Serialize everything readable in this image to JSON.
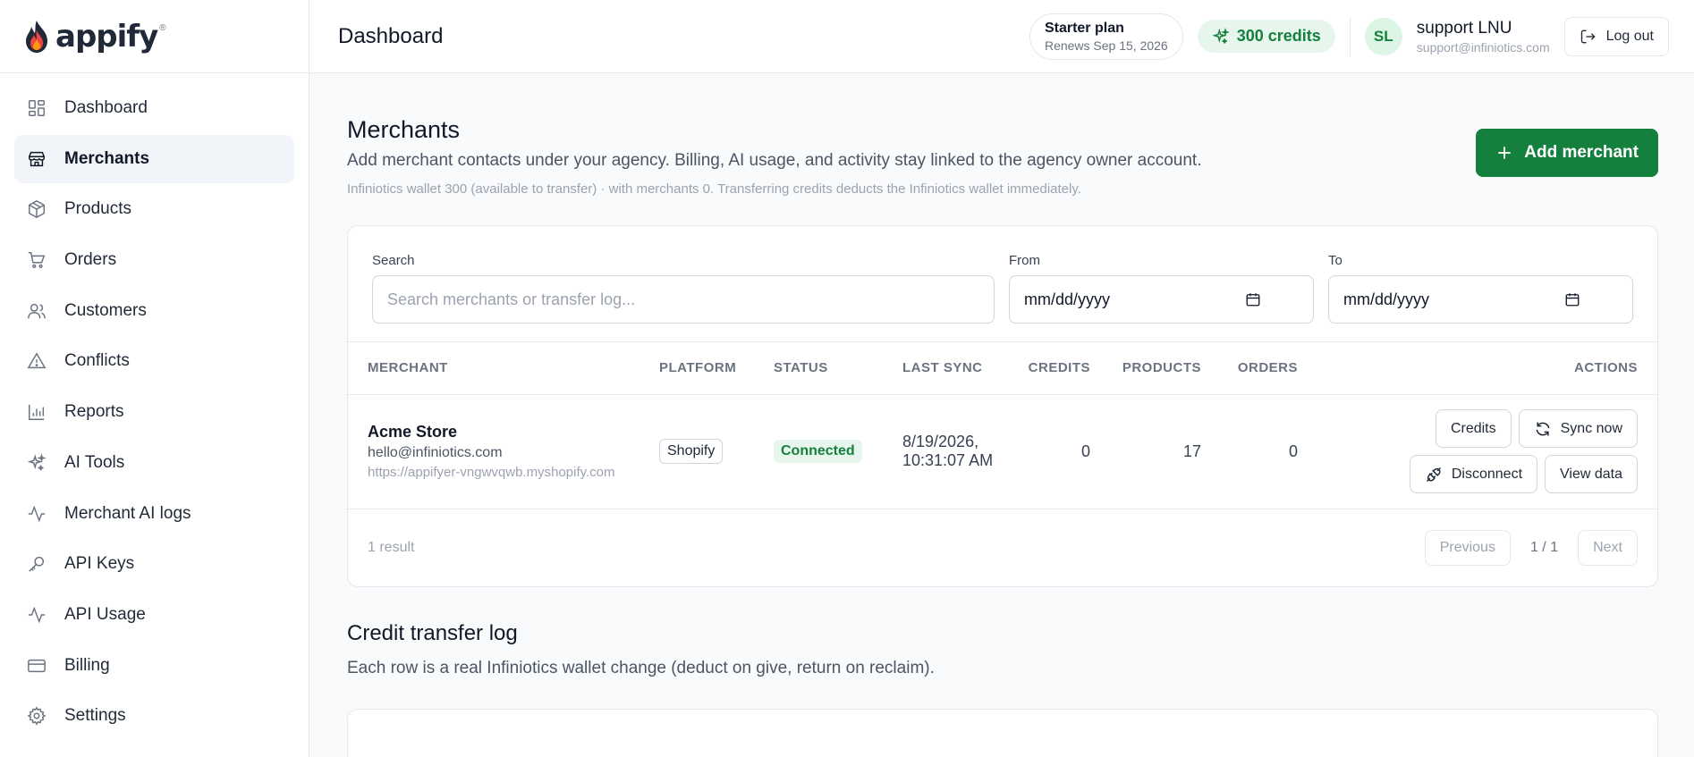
{
  "brand": {
    "name": "appify",
    "reg": "®"
  },
  "sidebar": {
    "items": [
      {
        "label": "Dashboard",
        "icon": "grid-icon"
      },
      {
        "label": "Merchants",
        "icon": "store-icon",
        "active": true
      },
      {
        "label": "Products",
        "icon": "box-icon"
      },
      {
        "label": "Orders",
        "icon": "cart-icon"
      },
      {
        "label": "Customers",
        "icon": "users-icon"
      },
      {
        "label": "Conflicts",
        "icon": "alert-icon"
      },
      {
        "label": "Reports",
        "icon": "bar-chart-icon"
      },
      {
        "label": "AI Tools",
        "icon": "sparkle-icon"
      },
      {
        "label": "Merchant AI logs",
        "icon": "activity-icon"
      },
      {
        "label": "API Keys",
        "icon": "key-icon"
      },
      {
        "label": "API Usage",
        "icon": "activity-icon"
      },
      {
        "label": "Billing",
        "icon": "credit-card-icon"
      },
      {
        "label": "Settings",
        "icon": "gear-icon"
      }
    ]
  },
  "header": {
    "title": "Dashboard",
    "plan": {
      "name": "Starter plan",
      "renews": "Renews Sep 15, 2026"
    },
    "credits": "300 credits",
    "user": {
      "initials": "SL",
      "name": "support LNU",
      "email": "support@infiniotics.com"
    },
    "logout_label": "Log out"
  },
  "page": {
    "title": "Merchants",
    "subtitle": "Add merchant contacts under your agency. Billing, AI usage, and activity stay linked to the agency owner account.",
    "note": "Infiniotics wallet 300 (available to transfer) · with merchants 0. Transferring credits deducts the Infiniotics wallet immediately.",
    "add_label": "Add merchant"
  },
  "filters": {
    "search_label": "Search",
    "search_placeholder": "Search merchants or transfer log...",
    "from_label": "From",
    "from_value": "mm/dd/yyyy",
    "to_label": "To",
    "to_value": "mm/dd/yyyy"
  },
  "table": {
    "headers": {
      "merchant": "MERCHANT",
      "platform": "PLATFORM",
      "status": "STATUS",
      "last_sync": "LAST SYNC",
      "credits": "CREDITS",
      "products": "PRODUCTS",
      "orders": "ORDERS",
      "actions": "ACTIONS"
    },
    "rows": [
      {
        "name": "Acme Store",
        "email": "hello@infiniotics.com",
        "url": "https://appifyer-vngwvqwb.myshopify.com",
        "platform": "Shopify",
        "status": "Connected",
        "last_sync_date": "8/19/2026,",
        "last_sync_time": "10:31:07 AM",
        "credits": "0",
        "products": "17",
        "orders": "0",
        "actions": {
          "credits": "Credits",
          "sync": "Sync now",
          "disconnect": "Disconnect",
          "view": "View data"
        }
      }
    ],
    "result_count": "1 result",
    "pager": {
      "previous": "Previous",
      "page": "1 / 1",
      "next": "Next"
    }
  },
  "transfer_log": {
    "title": "Credit transfer log",
    "subtitle": "Each row is a real Infiniotics wallet change (deduct on give, return on reclaim)."
  },
  "colors": {
    "accent": "#15803d",
    "accent_soft": "#e7f6ec"
  }
}
